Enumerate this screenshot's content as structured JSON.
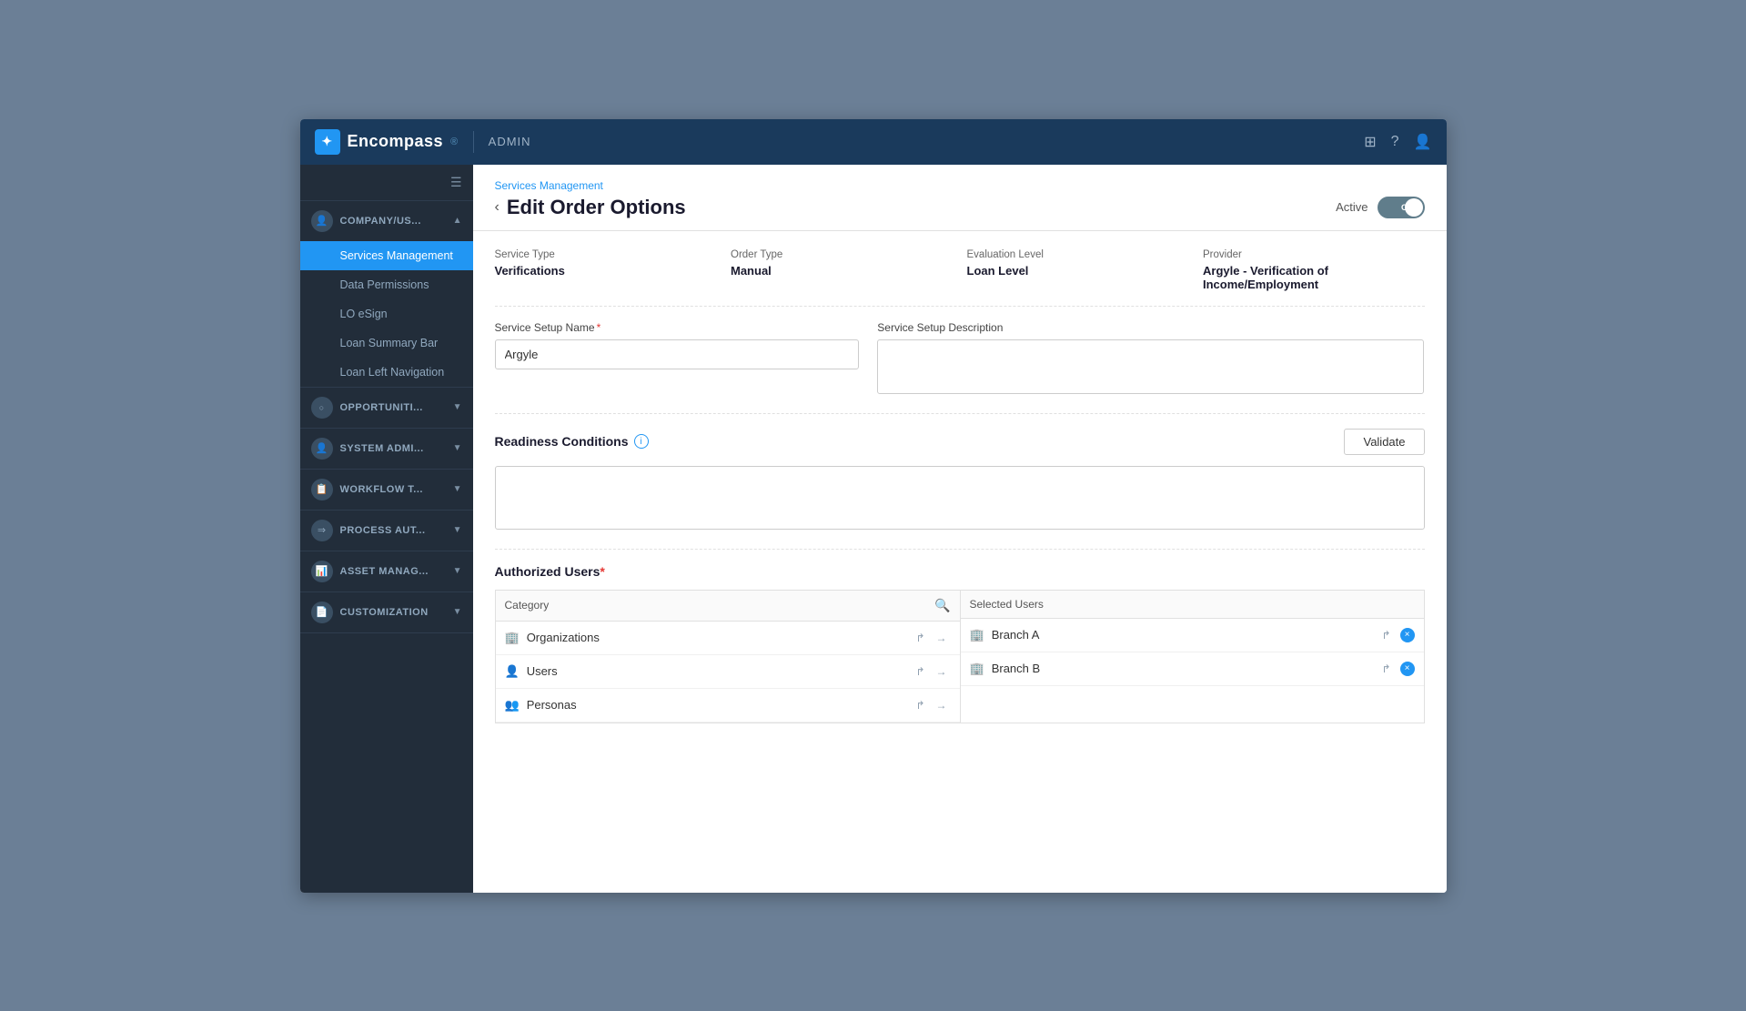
{
  "app": {
    "logo_text": "Encompass",
    "admin_label": "ADMIN",
    "logo_symbol": "✦"
  },
  "top_bar_icons": {
    "grid_icon": "⊞",
    "help_icon": "?",
    "user_icon": "👤"
  },
  "sidebar": {
    "toggle_icon": "☰",
    "sections": [
      {
        "id": "company",
        "icon": "👤",
        "label": "COMPANY/US...",
        "arrow": "▲",
        "items": [
          {
            "id": "services",
            "label": "Services Management",
            "active": true
          },
          {
            "id": "data-permissions",
            "label": "Data Permissions",
            "active": false
          },
          {
            "id": "lo-esign",
            "label": "LO eSign",
            "active": false
          },
          {
            "id": "loan-summary",
            "label": "Loan Summary Bar",
            "active": false
          },
          {
            "id": "loan-nav",
            "label": "Loan Left Navigation",
            "active": false
          }
        ]
      },
      {
        "id": "opportunities",
        "icon": "○",
        "label": "OPPORTUNITI...",
        "arrow": "▼",
        "items": []
      },
      {
        "id": "system-admin",
        "icon": "👤",
        "label": "SYSTEM ADMI...",
        "arrow": "▼",
        "items": []
      },
      {
        "id": "workflow",
        "icon": "📋",
        "label": "WORKFLOW T...",
        "arrow": "▼",
        "items": []
      },
      {
        "id": "process-aut",
        "icon": "⇒",
        "label": "PROCESS AUT...",
        "arrow": "▼",
        "items": []
      },
      {
        "id": "asset-manag",
        "icon": "📊",
        "label": "ASSET MANAG...",
        "arrow": "▼",
        "items": []
      },
      {
        "id": "customization",
        "icon": "📄",
        "label": "CUSTOMIZATION",
        "arrow": "▼",
        "items": []
      }
    ]
  },
  "breadcrumb": "Services Management",
  "page_title": "Edit Order Options",
  "back_arrow": "‹",
  "active_label": "Active",
  "toggle_text": "OFF",
  "info_fields": {
    "service_type": {
      "label": "Service Type",
      "value": "Verifications"
    },
    "order_type": {
      "label": "Order Type",
      "value": "Manual"
    },
    "evaluation_level": {
      "label": "Evaluation Level",
      "value": "Loan Level"
    },
    "provider": {
      "label": "Provider",
      "value": "Argyle - Verification of Income/Employment"
    }
  },
  "form": {
    "service_setup_name_label": "Service Setup Name",
    "service_setup_name_value": "Argyle",
    "service_setup_desc_label": "Service Setup Description",
    "service_setup_desc_value": ""
  },
  "readiness": {
    "title": "Readiness Conditions",
    "validate_label": "Validate",
    "textarea_value": ""
  },
  "authorized_users": {
    "title": "Authorized Users",
    "category_label": "Category",
    "selected_users_label": "Selected Users",
    "categories": [
      {
        "id": "organizations",
        "label": "Organizations",
        "icon": "🏢"
      },
      {
        "id": "users",
        "label": "Users",
        "icon": "👤"
      },
      {
        "id": "personas",
        "label": "Personas",
        "icon": "👥"
      }
    ],
    "selected": [
      {
        "id": "branch-a",
        "label": "Branch A",
        "icon": "🏢"
      },
      {
        "id": "branch-b",
        "label": "Branch B",
        "icon": "🏢"
      }
    ]
  }
}
